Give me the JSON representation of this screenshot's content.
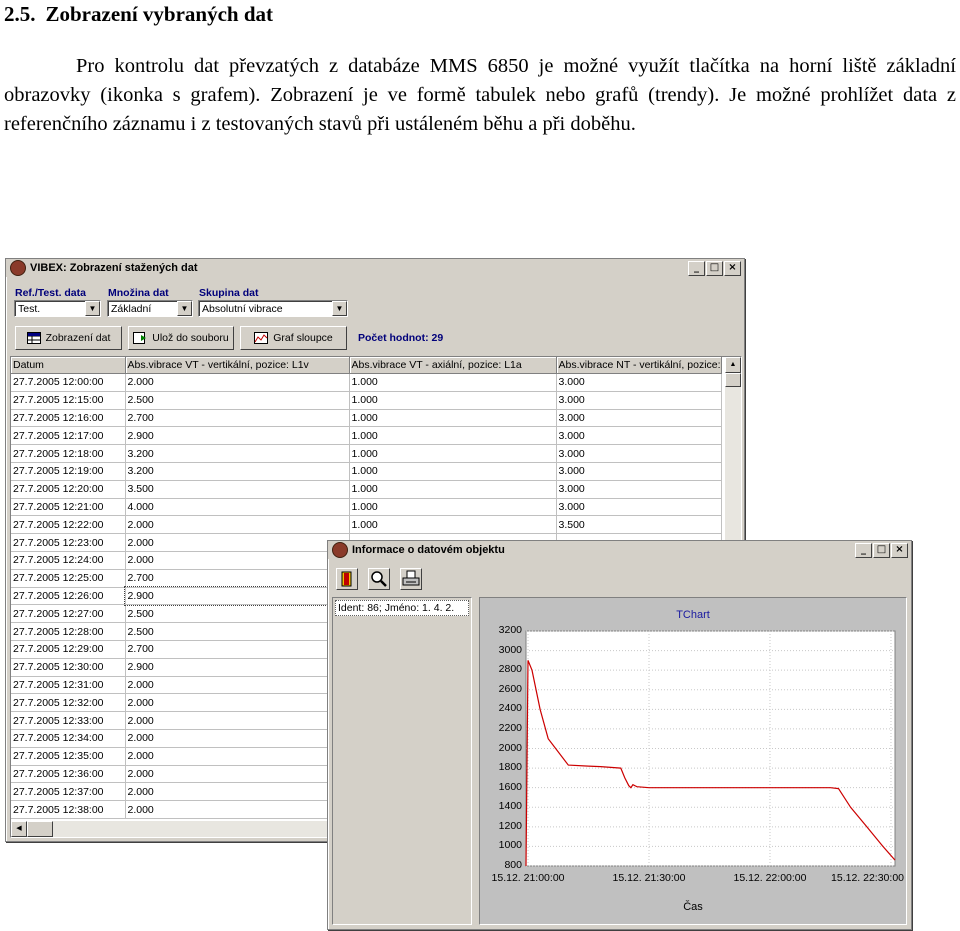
{
  "heading": {
    "number": "2.5.",
    "text": "Zobrazení vybraných dat"
  },
  "paragraph": "Pro kontrolu dat převzatých z databáze MMS 6850 je možné využít tlačítka na horní liště základní obrazovky (ikonka s grafem). Zobrazení je ve formě tabulek nebo grafů (trendy). Je možné prohlížet data z referenčního záznamu i z testovaných stavů při ustáleném běhu a při doběhu.",
  "main_window": {
    "title": "VIBEX: Zobrazení stažených dat",
    "labels": {
      "ref": "Ref./Test. data",
      "mnozina": "Množina dat",
      "skupina": "Skupina dat"
    },
    "selects": {
      "ref": "Test.",
      "mnozina": "Základní",
      "skupina": "Absolutní vibrace"
    },
    "buttons": {
      "zobrazeni": "Zobrazení dat",
      "uloz": "Ulož do souboru",
      "graf": "Graf sloupce"
    },
    "count_label": "Počet hodnot: 29",
    "columns": [
      "Datum",
      "Abs.vibrace VT - vertikální, pozice: L1v",
      "Abs.vibrace VT - axiální, pozice: L1a",
      "Abs.vibrace NT - vertikální, pozice: L"
    ],
    "rows": [
      [
        "27.7.2005 12:00:00",
        "2.000",
        "1.000",
        "3.000"
      ],
      [
        "27.7.2005 12:15:00",
        "2.500",
        "1.000",
        "3.000"
      ],
      [
        "27.7.2005 12:16:00",
        "2.700",
        "1.000",
        "3.000"
      ],
      [
        "27.7.2005 12:17:00",
        "2.900",
        "1.000",
        "3.000"
      ],
      [
        "27.7.2005 12:18:00",
        "3.200",
        "1.000",
        "3.000"
      ],
      [
        "27.7.2005 12:19:00",
        "3.200",
        "1.000",
        "3.000"
      ],
      [
        "27.7.2005 12:20:00",
        "3.500",
        "1.000",
        "3.000"
      ],
      [
        "27.7.2005 12:21:00",
        "4.000",
        "1.000",
        "3.000"
      ],
      [
        "27.7.2005 12:22:00",
        "2.000",
        "1.000",
        "3.500"
      ],
      [
        "27.7.2005 12:23:00",
        "2.000",
        "",
        ""
      ],
      [
        "27.7.2005 12:24:00",
        "2.000",
        "",
        ""
      ],
      [
        "27.7.2005 12:25:00",
        "2.700",
        "",
        ""
      ],
      [
        "27.7.2005 12:26:00",
        "2.900",
        "",
        ""
      ],
      [
        "27.7.2005 12:27:00",
        "2.500",
        "",
        ""
      ],
      [
        "27.7.2005 12:28:00",
        "2.500",
        "",
        ""
      ],
      [
        "27.7.2005 12:29:00",
        "2.700",
        "",
        ""
      ],
      [
        "27.7.2005 12:30:00",
        "2.900",
        "",
        ""
      ],
      [
        "27.7.2005 12:31:00",
        "2.000",
        "",
        ""
      ],
      [
        "27.7.2005 12:32:00",
        "2.000",
        "",
        ""
      ],
      [
        "27.7.2005 12:33:00",
        "2.000",
        "",
        ""
      ],
      [
        "27.7.2005 12:34:00",
        "2.000",
        "",
        ""
      ],
      [
        "27.7.2005 12:35:00",
        "2.000",
        "",
        ""
      ],
      [
        "27.7.2005 12:36:00",
        "2.000",
        "",
        ""
      ],
      [
        "27.7.2005 12:37:00",
        "2.000",
        "",
        ""
      ],
      [
        "27.7.2005 12:38:00",
        "2.000",
        "",
        ""
      ]
    ]
  },
  "info_window": {
    "title": "Informace o datovém objektu",
    "ident": "Ident: 86; Jméno: 1. 4. 2."
  },
  "chart_data": {
    "type": "line",
    "title": "TChart",
    "xlabel": "Čas",
    "ylabel": "",
    "ylim": [
      800,
      3200
    ],
    "yticks": [
      3200,
      3000,
      2800,
      2600,
      2400,
      2200,
      2000,
      1800,
      1600,
      1400,
      1200,
      1000,
      800
    ],
    "xlim": [
      "15.12. 20:59:30",
      "15.12. 22:31:00"
    ],
    "xticks": [
      "15.12. 21:00:00",
      "15.12. 21:30:00",
      "15.12. 22:00:00",
      "15.12. 22:30:00"
    ],
    "colors": {
      "line": "#cc0000"
    },
    "series": [
      {
        "x": [
          "15.12. 20:59:30",
          "15.12. 21:00:00",
          "15.12. 21:01:00",
          "15.12. 21:03:00",
          "15.12. 21:05:00",
          "15.12. 21:10:00",
          "15.12. 21:15:00",
          "15.12. 21:18:00",
          "15.12. 21:23:00",
          "15.12. 21:24:00",
          "15.12. 21:25:00",
          "15.12. 21:25:30",
          "15.12. 21:26:00",
          "15.12. 21:27:00",
          "15.12. 21:30:00",
          "15.12. 21:40:00",
          "15.12. 22:00:00",
          "15.12. 22:10:00",
          "15.12. 22:15:00",
          "15.12. 22:17:00",
          "15.12. 22:20:00",
          "15.12. 22:24:00",
          "15.12. 22:28:00",
          "15.12. 22:31:00"
        ],
        "y": [
          800,
          2900,
          2800,
          2400,
          2100,
          1830,
          1820,
          1815,
          1800,
          1700,
          1620,
          1600,
          1630,
          1610,
          1600,
          1600,
          1600,
          1600,
          1600,
          1590,
          1400,
          1200,
          1000,
          860
        ]
      }
    ]
  }
}
